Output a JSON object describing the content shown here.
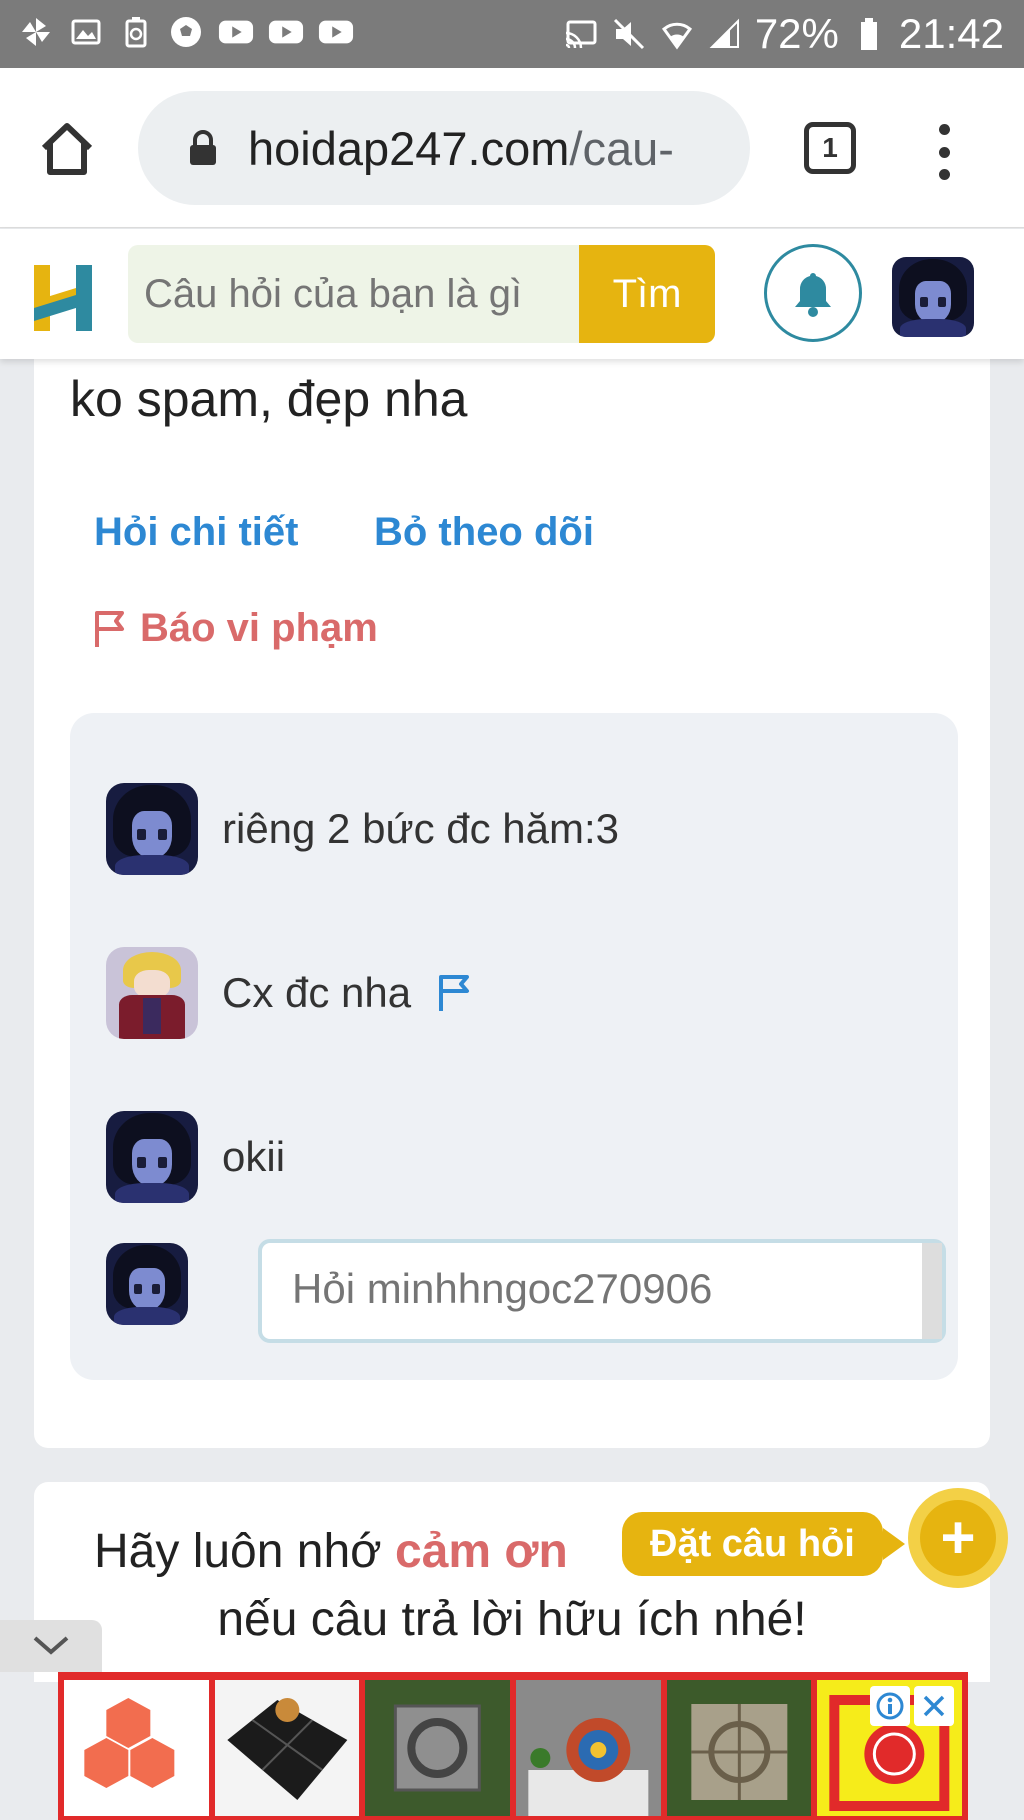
{
  "status_bar": {
    "battery": "72%",
    "time": "21:42"
  },
  "browser": {
    "url_host": "hoidap247.com",
    "url_rest": "/cau-",
    "tab_count": "1"
  },
  "header": {
    "search_placeholder": "Câu hỏi của bạn là gì",
    "search_button": "Tìm"
  },
  "question": {
    "text": "ko spam, đẹp nha",
    "ask_detail": "Hỏi chi tiết",
    "unfollow": "Bỏ theo dõi",
    "report": "Báo vi phạm"
  },
  "comments": [
    {
      "text": "riêng 2 bức đc hăm:3"
    },
    {
      "text": "Cx đc nha"
    },
    {
      "text": "okii"
    }
  ],
  "reply": {
    "placeholder": "Hỏi minhhngoc270906"
  },
  "reminder": {
    "line1_prefix": "Hãy luôn nhớ ",
    "line1_highlight": "cảm ơn",
    "line2": "nếu câu trả lời hữu ích nhé!"
  },
  "ask_button": {
    "label": "Đặt câu hỏi",
    "icon": "+"
  },
  "colors": {
    "brand_yellow": "#e6b410",
    "link_blue": "#2d88d3",
    "report_red": "#d96a6a",
    "teal": "#2e8aa0"
  }
}
